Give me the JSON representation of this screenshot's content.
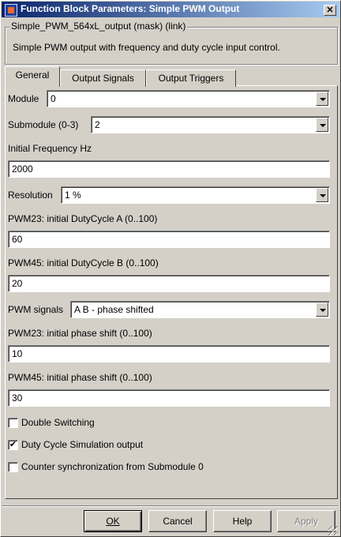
{
  "window": {
    "title": "Function Block Parameters: Simple PWM Output",
    "close_glyph": "✕"
  },
  "mask": {
    "group_title": "Simple_PWM_564xL_output (mask) (link)",
    "description": "Simple PWM output with frequency and duty cycle input control."
  },
  "tabs": [
    {
      "label": "General",
      "active": true
    },
    {
      "label": "Output Signals",
      "active": false
    },
    {
      "label": "Output Triggers",
      "active": false
    }
  ],
  "general": {
    "module": {
      "label": "Module",
      "value": "0"
    },
    "submodule": {
      "label": "Submodule (0-3)",
      "value": "2"
    },
    "initial_frequency": {
      "label": "Initial Frequency Hz",
      "value": "2000"
    },
    "resolution": {
      "label": "Resolution",
      "value": "1 %"
    },
    "pwm23_duty": {
      "label": "PWM23: initial DutyCycle A (0..100)",
      "value": "60"
    },
    "pwm45_duty": {
      "label": "PWM45: initial DutyCycle B (0..100)",
      "value": "20"
    },
    "pwm_signals": {
      "label": "PWM signals",
      "value": "A B - phase shifted"
    },
    "pwm23_phase": {
      "label": "PWM23: initial phase shift (0..100)",
      "value": "10"
    },
    "pwm45_phase": {
      "label": "PWM45: initial phase shift (0..100)",
      "value": "30"
    },
    "double_switching": {
      "label": "Double Switching",
      "checked": false
    },
    "duty_cycle_sim": {
      "label": "Duty Cycle Simulation output",
      "checked": true,
      "check_glyph": "✔"
    },
    "counter_sync": {
      "label": "Counter synchronization from Submodule 0",
      "checked": false
    }
  },
  "buttons": {
    "ok": "OK",
    "cancel": "Cancel",
    "help": "Help",
    "apply": "Apply"
  }
}
